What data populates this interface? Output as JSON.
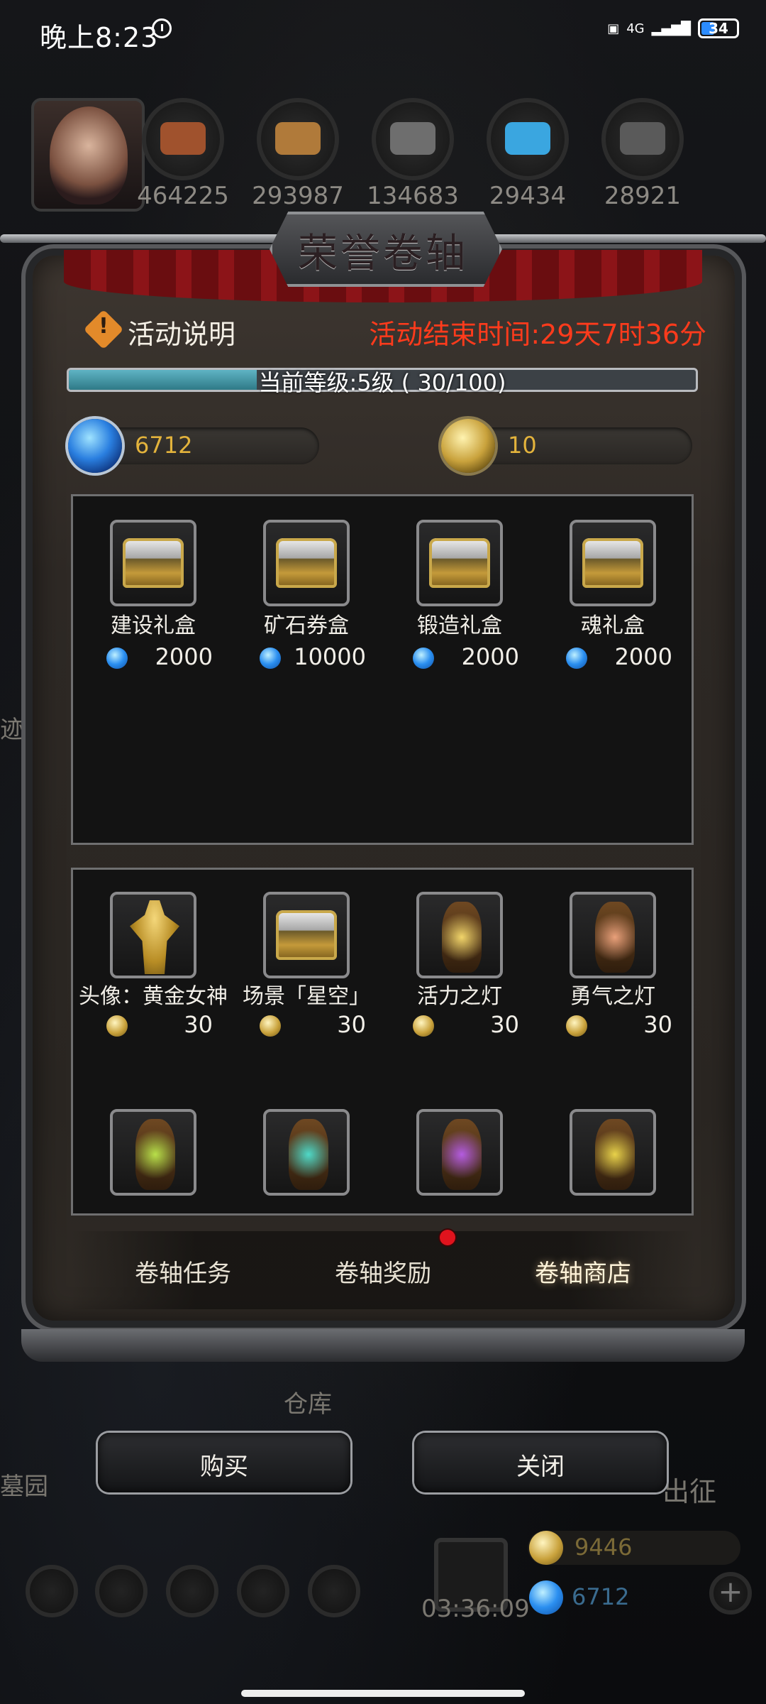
{
  "status_bar": {
    "time": "晚上8:23",
    "network": "4G",
    "battery": "34"
  },
  "header": {
    "resources": [
      {
        "value": "464225",
        "icon": "wood-log-icon",
        "color": "#a0522d"
      },
      {
        "value": "293987",
        "icon": "plank-icon",
        "color": "#b07a3a"
      },
      {
        "value": "134683",
        "icon": "iron-ingot-icon",
        "color": "#6e6e6e"
      },
      {
        "value": "29434",
        "icon": "crystal-icon",
        "color": "#3aa6e0"
      },
      {
        "value": "28921",
        "icon": "steel-ingot-icon",
        "color": "#5a5a5a"
      }
    ]
  },
  "modal": {
    "title": "荣誉卷轴",
    "info_label": "活动说明",
    "end_time": "活动结束时间:29天7时36分",
    "level_text": "当前等级:5级 ( 30/100)",
    "level_progress": 0.3,
    "currencies": {
      "gems": "6712",
      "coins": "10"
    },
    "gem_shop": [
      {
        "name": "建设礼盒",
        "price": "2000"
      },
      {
        "name": "矿石券盒",
        "price": "10000"
      },
      {
        "name": "锻造礼盒",
        "price": "2000"
      },
      {
        "name": "魂礼盒",
        "price": "2000"
      }
    ],
    "coin_shop": [
      {
        "name": "头像：黄金女神",
        "price": "30",
        "kind": "statue"
      },
      {
        "name": "场景「星空」",
        "price": "30",
        "kind": "chest"
      },
      {
        "name": "活力之灯",
        "price": "30",
        "kind": "lamp",
        "color": "#f2d56a"
      },
      {
        "name": "勇气之灯",
        "price": "30",
        "kind": "lamp",
        "color": "#e9a07a"
      }
    ],
    "coin_shop_row2": [
      {
        "kind": "lamp",
        "color": "#b8e04a"
      },
      {
        "kind": "lamp",
        "color": "#4fd9c8"
      },
      {
        "kind": "lamp",
        "color": "#b45ce0"
      },
      {
        "kind": "lamp",
        "color": "#e8d24a"
      }
    ],
    "tabs": [
      "卷轴任务",
      "卷轴奖励",
      "卷轴商店"
    ],
    "buttons": {
      "buy": "购买",
      "close": "关闭"
    }
  },
  "background": {
    "warehouse": "仓库",
    "cemetery": "墓园",
    "expedition": "出征",
    "gold": "9446",
    "gems": "6712",
    "timer": "03:36:09",
    "side_left": "迹"
  }
}
